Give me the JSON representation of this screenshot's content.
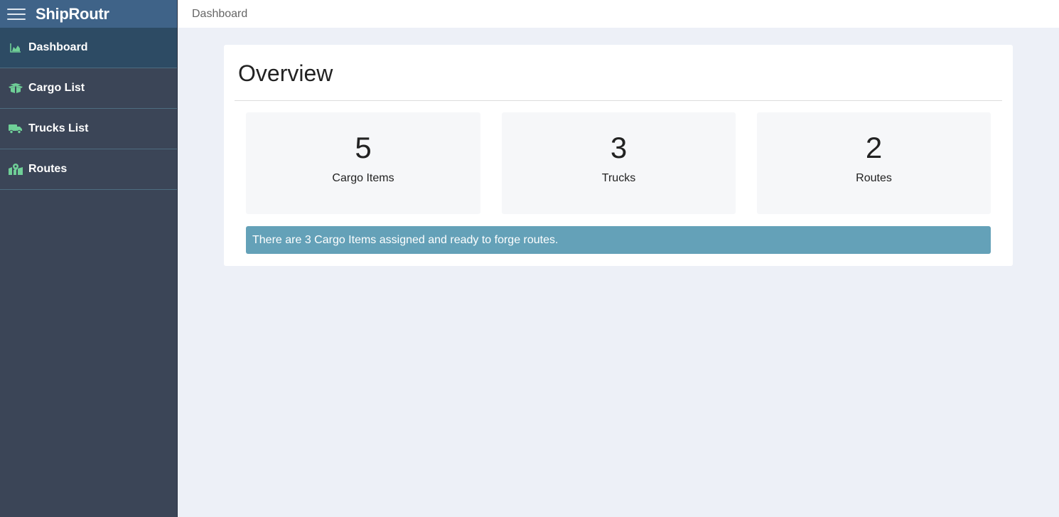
{
  "app": {
    "brand": "ShipRoutr"
  },
  "sidebar": {
    "items": [
      {
        "label": "Dashboard",
        "icon": "chart-area-icon"
      },
      {
        "label": "Cargo List",
        "icon": "box-icon"
      },
      {
        "label": "Trucks List",
        "icon": "truck-icon"
      },
      {
        "label": "Routes",
        "icon": "map-marked-icon"
      }
    ]
  },
  "topbar": {
    "breadcrumb": "Dashboard"
  },
  "overview": {
    "title": "Overview",
    "stats": [
      {
        "value": "5",
        "label": "Cargo Items"
      },
      {
        "value": "3",
        "label": "Trucks"
      },
      {
        "value": "2",
        "label": "Routes"
      }
    ],
    "alert": "There are 3 Cargo Items assigned and ready to forge routes."
  },
  "colors": {
    "sidebar_bg": "#3b4557",
    "brand_bg": "#3f6388",
    "active_item_bg": "#2d4b64",
    "icon_green": "#6fcf97",
    "alert_bg": "#64a1b8",
    "page_bg": "#edf0f7"
  }
}
